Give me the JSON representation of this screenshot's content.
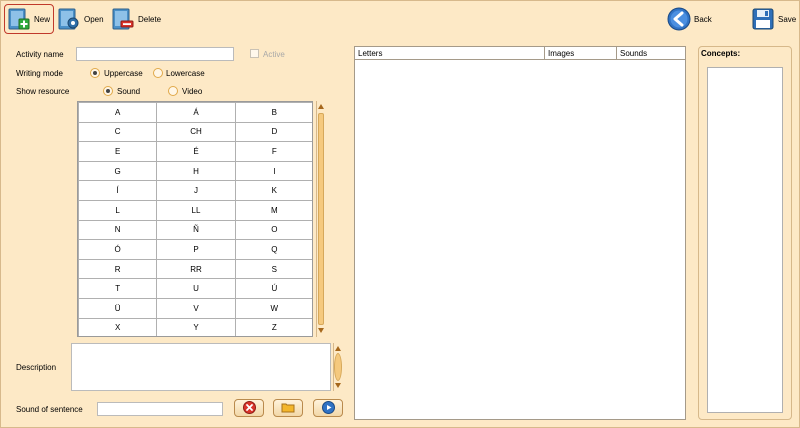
{
  "toolbar": {
    "new_label": "New",
    "open_label": "Open",
    "delete_label": "Delete",
    "back_label": "Back",
    "save_label": "Save"
  },
  "form": {
    "activity_name_label": "Activity name",
    "activity_name_value": "",
    "active_label": "Active",
    "active_checked": false,
    "writing_mode_label": "Writing mode",
    "uppercase_label": "Uppercase",
    "lowercase_label": "Lowercase",
    "writing_mode_selected": "Uppercase",
    "show_resource_label": "Show resource",
    "sound_label": "Sound",
    "video_label": "Video",
    "show_resource_selected": "Sound",
    "description_label": "Description",
    "description_value": "",
    "sound_of_sentence_label": "Sound of sentence",
    "sound_of_sentence_value": ""
  },
  "letters": [
    [
      "A",
      "Á",
      "B"
    ],
    [
      "C",
      "CH",
      "D"
    ],
    [
      "E",
      "É",
      "F"
    ],
    [
      "G",
      "H",
      "I"
    ],
    [
      "Í",
      "J",
      "K"
    ],
    [
      "L",
      "LL",
      "M"
    ],
    [
      "N",
      "Ñ",
      "O"
    ],
    [
      "Ó",
      "P",
      "Q"
    ],
    [
      "R",
      "RR",
      "S"
    ],
    [
      "T",
      "U",
      "Ú"
    ],
    [
      "Ü",
      "V",
      "W"
    ],
    [
      "X",
      "Y",
      "Z"
    ]
  ],
  "table": {
    "columns": [
      "Letters",
      "Images",
      "Sounds"
    ]
  },
  "concepts": {
    "label": "Concepts:",
    "items": []
  },
  "colors": {
    "background": "#fde9c6",
    "selected_border": "#c0392b"
  }
}
